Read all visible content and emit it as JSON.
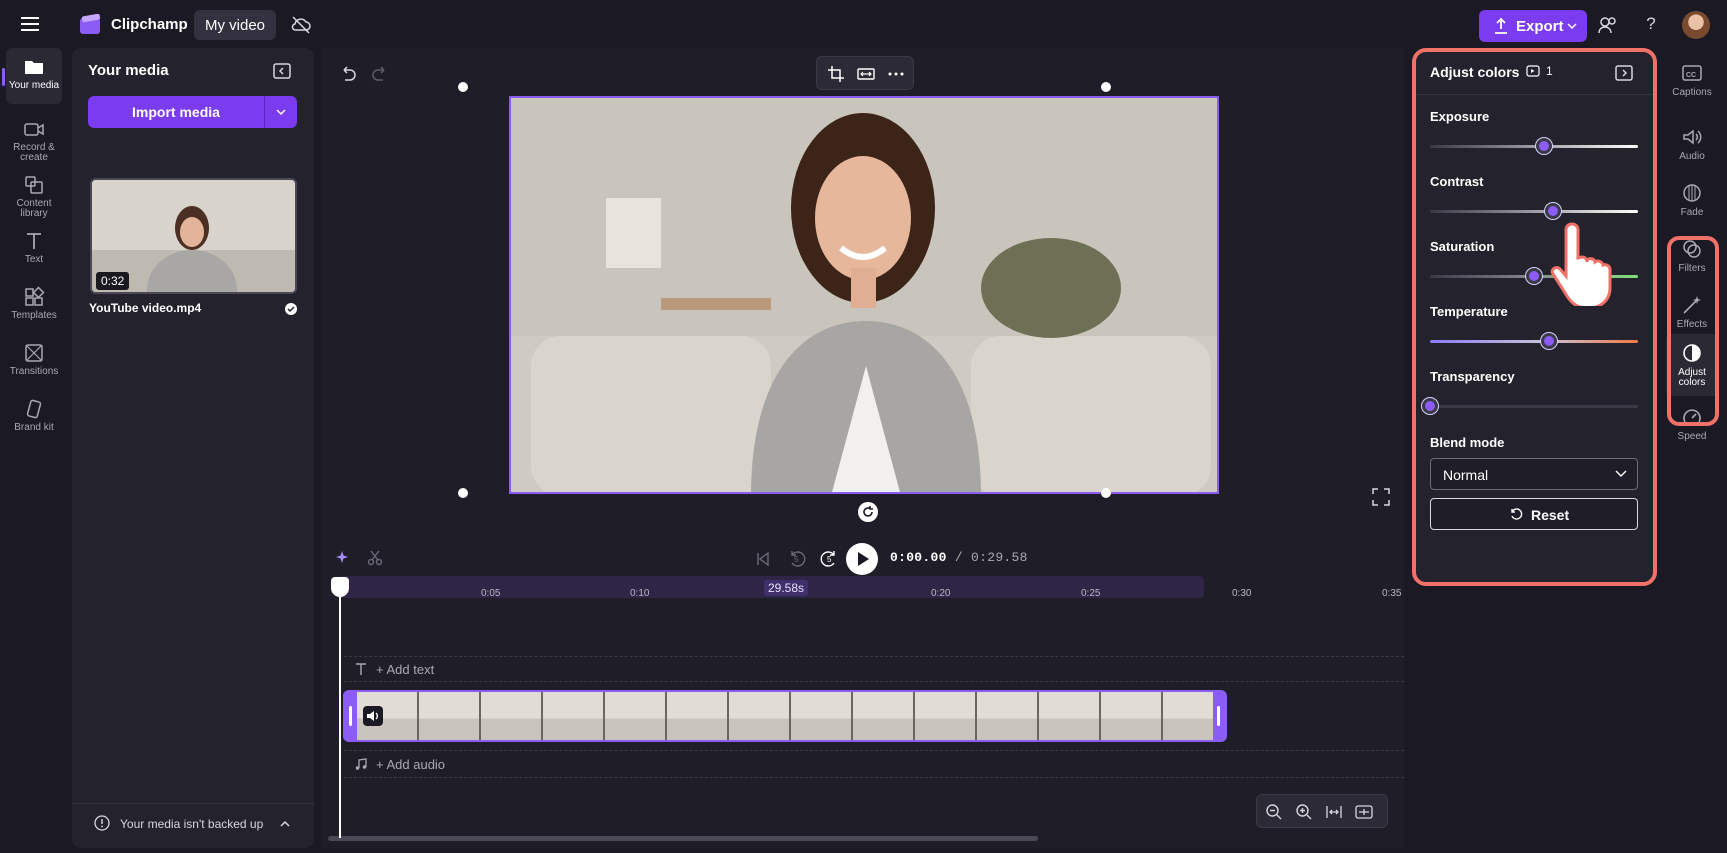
{
  "app": {
    "name": "Clipchamp",
    "project_tab": "My video"
  },
  "header": {
    "export_label": "Export",
    "help_label": "?"
  },
  "left_rail": {
    "items": [
      {
        "label": "Your media",
        "icon": "folder-icon",
        "active": true
      },
      {
        "label": "Record & create",
        "icon": "camera-icon"
      },
      {
        "label": "Content library",
        "icon": "library-icon"
      },
      {
        "label": "Text",
        "icon": "text-icon"
      },
      {
        "label": "Templates",
        "icon": "templates-icon"
      },
      {
        "label": "Transitions",
        "icon": "transitions-icon"
      },
      {
        "label": "Brand kit",
        "icon": "brand-kit-icon"
      }
    ]
  },
  "media_panel": {
    "title": "Your media",
    "import_label": "Import media",
    "file": {
      "duration": "0:32",
      "name": "YouTube video.mp4"
    },
    "backup_text": "Your media isn't backed up"
  },
  "timeline": {
    "current_time": "0:00.00",
    "total_time": "/ 0:29.58",
    "duration_badge": "29.58s",
    "ticks": [
      {
        "label": "0:05"
      },
      {
        "label": "0:10"
      },
      {
        "label": "0:20"
      },
      {
        "label": "0:25"
      },
      {
        "label": "0:30"
      },
      {
        "label": "0:35"
      }
    ],
    "add_text": "+ Add text",
    "add_audio": "+ Add audio",
    "skip_back_label": "5",
    "skip_fwd_label": "5"
  },
  "adjust_colors": {
    "title": "Adjust colors",
    "selected_count": "1",
    "sliders": [
      {
        "label": "Exposure",
        "value_fraction": 0.55
      },
      {
        "label": "Contrast",
        "value_fraction": 0.59
      },
      {
        "label": "Saturation",
        "value_fraction": 0.5
      },
      {
        "label": "Temperature",
        "value_fraction": 0.57
      },
      {
        "label": "Transparency",
        "value_fraction": 0.0
      }
    ],
    "blend_mode_label": "Blend mode",
    "blend_mode_value": "Normal",
    "reset_label": "Reset"
  },
  "right_rail": {
    "items": [
      {
        "label": "Captions",
        "icon": "captions-icon"
      },
      {
        "label": "Audio",
        "icon": "audio-icon"
      },
      {
        "label": "Fade",
        "icon": "fade-icon"
      },
      {
        "label": "Filters",
        "icon": "filters-icon"
      },
      {
        "label": "Effects",
        "icon": "effects-icon"
      },
      {
        "label": "Adjust colors",
        "icon": "adjust-colors-icon",
        "active": true
      },
      {
        "label": "Speed",
        "icon": "speed-icon"
      }
    ]
  },
  "colors": {
    "accent": "#7b3bef",
    "highlight": "#f07167",
    "background": "#1b1a24"
  }
}
